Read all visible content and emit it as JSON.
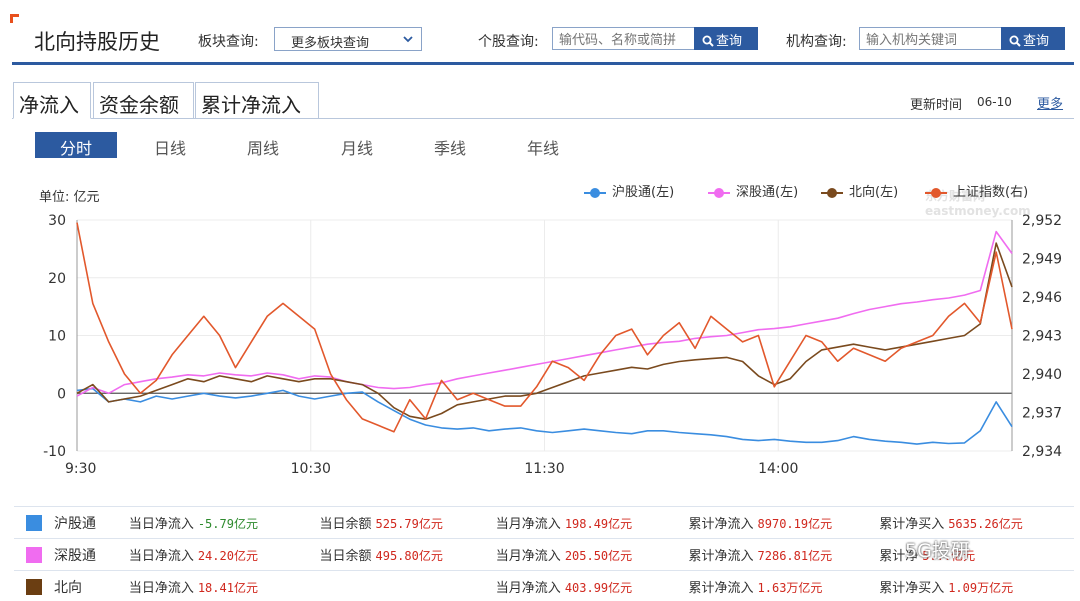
{
  "header": {
    "title": "北向持股历史",
    "sector_label": "板块查询:",
    "sector_select": "更多板块查询",
    "stock_label": "个股查询:",
    "stock_placeholder": "输代码、名称或简拼",
    "stock_button": "查询",
    "inst_label": "机构查询:",
    "inst_placeholder": "输入机构关键词",
    "inst_button": "查询"
  },
  "tabs": [
    {
      "label": "净流入",
      "active": true
    },
    {
      "label": "资金余额",
      "active": false
    },
    {
      "label": "累计净流入",
      "active": false
    }
  ],
  "update": {
    "label": "更新时间",
    "time": "06-10",
    "more": "更多"
  },
  "periods": [
    {
      "label": "分时",
      "active": true
    },
    {
      "label": "日线"
    },
    {
      "label": "周线"
    },
    {
      "label": "月线"
    },
    {
      "label": "季线"
    },
    {
      "label": "年线"
    }
  ],
  "chart_data": {
    "type": "line",
    "unit_label": "单位: 亿元",
    "x_ticks": [
      "9:30",
      "10:30",
      "11:30",
      "14:00"
    ],
    "y_left": {
      "min": -10,
      "max": 30,
      "ticks": [
        30,
        20,
        10,
        0,
        -10
      ]
    },
    "y_right": {
      "min": 2934,
      "max": 2952,
      "ticks": [
        "2,952",
        "2,949",
        "2,946",
        "2,943",
        "2,940",
        "2,937",
        "2,934"
      ]
    },
    "grid": true,
    "legend_position": "top-right",
    "series": [
      {
        "name": "沪股通(左)",
        "axis": "left",
        "color": "#3a8de0",
        "values": [
          0.5,
          0.8,
          -1.5,
          -1.0,
          -1.5,
          -0.5,
          -1.0,
          -0.5,
          0,
          -0.5,
          -0.8,
          -0.5,
          0,
          0.5,
          -0.5,
          -1.0,
          -0.5,
          0,
          0.2,
          -1.5,
          -3.0,
          -4.5,
          -5.5,
          -6.0,
          -6.2,
          -6.0,
          -6.5,
          -6.2,
          -6.0,
          -6.5,
          -6.8,
          -6.5,
          -6.2,
          -6.5,
          -6.8,
          -7.0,
          -6.5,
          -6.5,
          -6.8,
          -7.0,
          -7.2,
          -7.5,
          -8.0,
          -8.2,
          -8.0,
          -8.3,
          -8.5,
          -8.5,
          -8.2,
          -7.5,
          -8.0,
          -8.3,
          -8.5,
          -8.8,
          -8.5,
          -8.7,
          -8.6,
          -6.5,
          -1.5,
          -5.8
        ]
      },
      {
        "name": "深股通(左)",
        "axis": "left",
        "color": "#f06cf0",
        "values": [
          -0.5,
          1.0,
          0,
          1.5,
          2.0,
          2.5,
          2.8,
          3.2,
          3.0,
          3.5,
          3.2,
          3.0,
          3.5,
          3.2,
          2.5,
          3.0,
          2.8,
          2.0,
          1.5,
          1.0,
          0.8,
          1.0,
          1.5,
          1.8,
          2.5,
          3.0,
          3.5,
          4.0,
          4.5,
          5.0,
          5.5,
          6.0,
          6.5,
          7.0,
          7.5,
          8.0,
          8.5,
          8.8,
          9.0,
          9.5,
          9.8,
          10.0,
          10.5,
          11.0,
          11.2,
          11.5,
          12.0,
          12.5,
          13.0,
          13.8,
          14.5,
          15.0,
          15.5,
          15.8,
          16.2,
          16.5,
          17.0,
          17.8,
          28.0,
          24.2
        ]
      },
      {
        "name": "北向(左)",
        "axis": "left",
        "color": "#7a4a1e",
        "values": [
          0,
          1.5,
          -1.5,
          -1.0,
          -0.5,
          0.5,
          1.5,
          2.5,
          2.0,
          3.0,
          2.5,
          2.0,
          3.0,
          2.5,
          2.0,
          2.5,
          2.5,
          2.0,
          1.5,
          0,
          -2.5,
          -4.0,
          -4.5,
          -3.5,
          -2.0,
          -1.5,
          -1.0,
          -0.5,
          -0.5,
          0,
          1.0,
          2.0,
          3.0,
          3.5,
          4.0,
          4.5,
          4.2,
          5.0,
          5.5,
          5.8,
          6.0,
          6.2,
          5.5,
          3.0,
          1.5,
          2.5,
          5.5,
          7.5,
          8.0,
          8.5,
          8.0,
          7.5,
          8.0,
          8.5,
          9.0,
          9.5,
          10.0,
          12.0,
          26.0,
          18.4
        ]
      },
      {
        "name": "上证指数(右)",
        "axis": "right",
        "color": "#e2582c",
        "values": [
          2951.8,
          2945.5,
          2942.5,
          2940.0,
          2938.5,
          2939.5,
          2941.5,
          2943.0,
          2944.5,
          2943.0,
          2940.5,
          2942.5,
          2944.5,
          2945.5,
          2944.5,
          2943.5,
          2940.0,
          2938.0,
          2936.5,
          2936.0,
          2935.5,
          2938.0,
          2936.5,
          2939.5,
          2938.0,
          2938.5,
          2938.0,
          2937.5,
          2937.5,
          2939.0,
          2941.0,
          2940.5,
          2939.5,
          2941.5,
          2943.0,
          2943.5,
          2941.5,
          2943.0,
          2944.0,
          2942.0,
          2944.5,
          2943.5,
          2942.5,
          2943.0,
          2939.0,
          2941.0,
          2943.0,
          2942.5,
          2941.0,
          2942.0,
          2941.5,
          2941.0,
          2942.0,
          2942.5,
          2943.0,
          2944.5,
          2945.5,
          2944.0,
          2949.5,
          2943.5
        ]
      }
    ]
  },
  "legend": [
    {
      "label": "沪股通(左)",
      "color": "#3a8de0"
    },
    {
      "label": "深股通(左)",
      "color": "#f06cf0"
    },
    {
      "label": "北向(左)",
      "color": "#7a4a1e"
    },
    {
      "label": "上证指数(右)",
      "color": "#e2582c"
    }
  ],
  "watermark": "东方财富网 eastmoney.com",
  "stats": [
    {
      "name": "沪股通",
      "color": "#3a8de0",
      "day_inflow_label": "当日净流入",
      "day_inflow": "-5.79亿元",
      "day_inflow_neg": true,
      "day_balance_label": "当日余额",
      "day_balance": "525.79亿元",
      "month_inflow_label": "当月净流入",
      "month_inflow": "198.49亿元",
      "cum_inflow_label": "累计净流入",
      "cum_inflow": "8970.19亿元",
      "cum_buy_label": "累计净买入",
      "cum_buy": "5635.26亿元"
    },
    {
      "name": "深股通",
      "color": "#f06cf0",
      "day_inflow_label": "当日净流入",
      "day_inflow": "24.20亿元",
      "day_inflow_neg": false,
      "day_balance_label": "当日余额",
      "day_balance": "495.80亿元",
      "month_inflow_label": "当月净流入",
      "month_inflow": "205.50亿元",
      "cum_inflow_label": "累计净流入",
      "cum_inflow": "7286.81亿元",
      "cum_buy_label": "累计净",
      "cum_buy": "5...亿元"
    },
    {
      "name": "北向",
      "color": "#6b3e12",
      "day_inflow_label": "当日净流入",
      "day_inflow": "18.41亿元",
      "day_inflow_neg": false,
      "day_balance_label": "",
      "day_balance": "",
      "month_inflow_label": "当月净流入",
      "month_inflow": "403.99亿元",
      "cum_inflow_label": "累计净流入",
      "cum_inflow": "1.63万亿元",
      "cum_buy_label": "累计净买入",
      "cum_buy": "1.09万亿元"
    }
  ],
  "overlay_text": "5G投研"
}
